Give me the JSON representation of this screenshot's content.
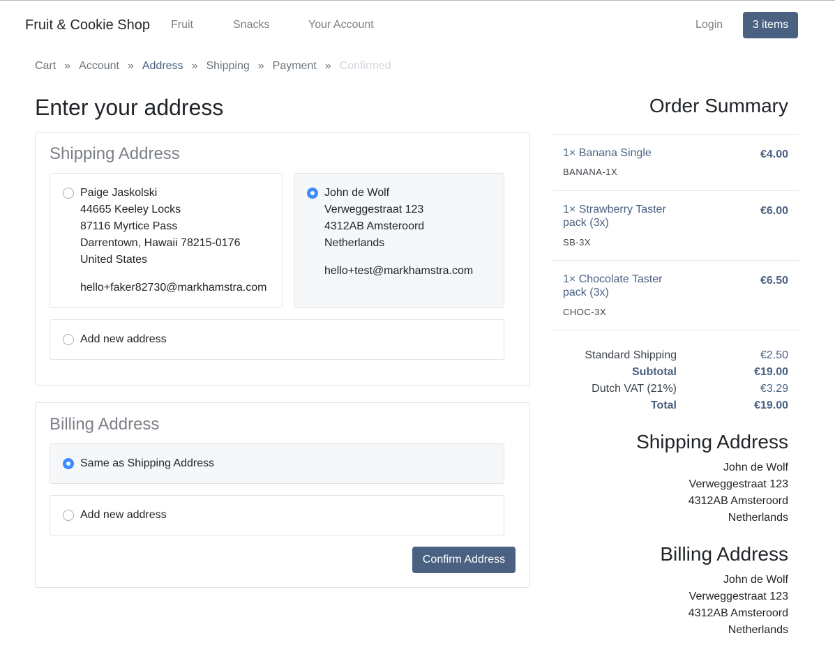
{
  "nav": {
    "brand": "Fruit & Cookie Shop",
    "links": [
      "Fruit",
      "Snacks",
      "Your Account"
    ],
    "login": "Login",
    "cart": "3 items"
  },
  "breadcrumb": [
    {
      "label": "Cart",
      "state": "done"
    },
    {
      "label": "Account",
      "state": "done"
    },
    {
      "label": "Address",
      "state": "active"
    },
    {
      "label": "Shipping",
      "state": "done"
    },
    {
      "label": "Payment",
      "state": "done"
    },
    {
      "label": "Confirmed",
      "state": "disabled"
    }
  ],
  "breadcrumb_separator": "»",
  "page_title": "Enter your address",
  "shipping": {
    "title": "Shipping Address",
    "options": [
      {
        "checked": false,
        "lines": [
          "Paige Jaskolski",
          "44665 Keeley Locks",
          "87116 Myrtice Pass",
          "Darrentown, Hawaii 78215-0176",
          "United States"
        ],
        "email": "hello+faker82730@markhamstra.com"
      },
      {
        "checked": true,
        "lines": [
          "John de Wolf",
          "Verweggestraat 123",
          "4312AB Amsteroord",
          "Netherlands"
        ],
        "email": "hello+test@markhamstra.com"
      }
    ],
    "add_new": "Add new address"
  },
  "billing": {
    "title": "Billing Address",
    "same_as": "Same as Shipping Address",
    "add_new": "Add new address",
    "confirm": "Confirm Address"
  },
  "summary": {
    "title": "Order Summary",
    "items": [
      {
        "name": "1× Banana Single",
        "sku": "BANANA-1X",
        "price": "€4.00"
      },
      {
        "name": "1× Strawberry Taster pack (3x)",
        "sku": "SB-3X",
        "price": "€6.00"
      },
      {
        "name": "1× Chocolate Taster pack (3x)",
        "sku": "CHOC-3X",
        "price": "€6.50"
      }
    ],
    "totals": [
      {
        "label": "Standard Shipping",
        "value": "€2.50",
        "bold": false
      },
      {
        "label": "Subtotal",
        "value": "€19.00",
        "bold": true
      },
      {
        "label": "Dutch VAT (21%)",
        "value": "€3.29",
        "bold": false
      },
      {
        "label": "Total",
        "value": "€19.00",
        "bold": true
      }
    ],
    "shipping_title": "Shipping Address",
    "shipping_lines": [
      "John de Wolf",
      "Verweggestraat 123",
      "4312AB Amsteroord",
      "Netherlands"
    ],
    "billing_title": "Billing Address",
    "billing_lines": [
      "John de Wolf",
      "Verweggestraat 123",
      "4312AB Amsteroord",
      "Netherlands"
    ]
  },
  "colors": {
    "primary": "#4a6181",
    "link": "#44607f",
    "radio_checked": "#3d8bfd",
    "selected_bg": "#f6f7f9"
  }
}
